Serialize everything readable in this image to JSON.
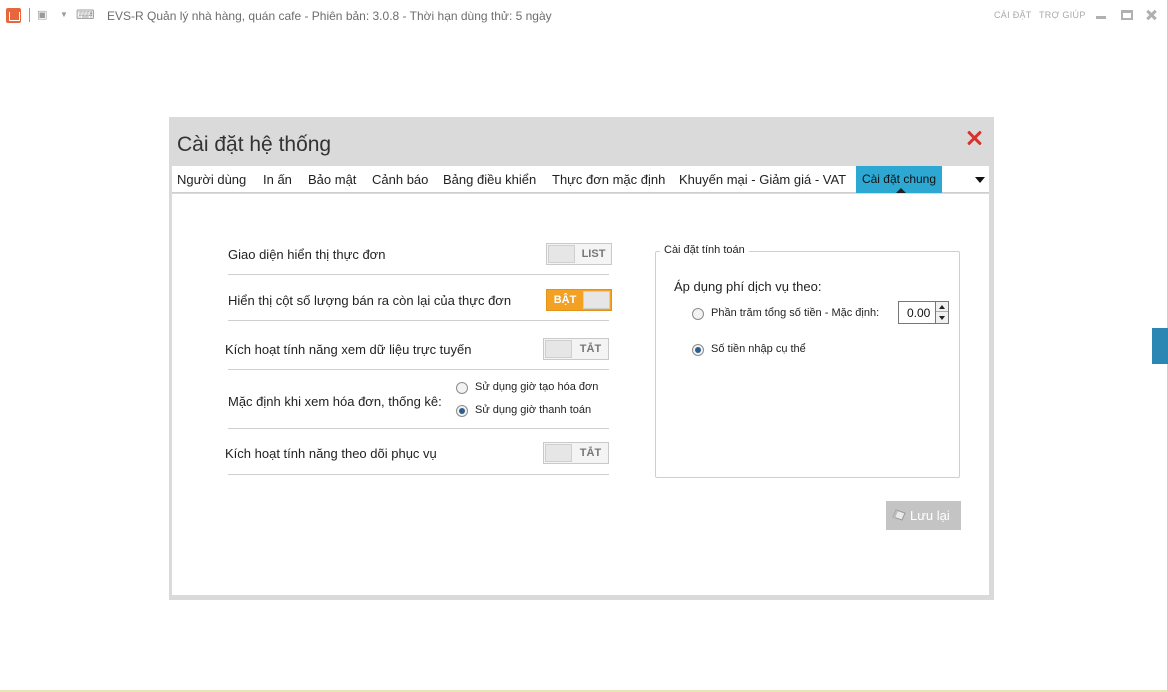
{
  "window": {
    "title": "EVS-R Quản lý nhà hàng, quán cafe - Phiên bản: 3.0.8 - Thời hạn dùng thử: 5 ngày",
    "links": {
      "settings": "CÀI ĐẶT",
      "help": "TRỢ GIÚP"
    }
  },
  "dialog": {
    "title": "Cài đặt hệ thống",
    "tabs": [
      "Người dùng",
      "In ấn",
      "Bảo mật",
      "Cảnh báo",
      "Bảng điều khiển",
      "Thực đơn mặc định",
      "Khuyến mại - Giảm giá - VAT",
      "Cài đặt chung"
    ],
    "active_tab": "Cài đặt chung"
  },
  "settings": {
    "menu_display": {
      "label": "Giao diện hiển thị thực đơn",
      "value": "LIST",
      "on": false
    },
    "show_remaining": {
      "label": "Hiển thị cột số lượng bán ra còn lại của thực đơn",
      "value": "BẬT",
      "on": true
    },
    "online_data": {
      "label": "Kích hoạt tính năng xem dữ liệu trực tuyến",
      "value": "TẮT",
      "on": false
    },
    "invoice_default": {
      "label": "Mặc định khi xem hóa đơn, thống kê:",
      "options": [
        "Sử dụng giờ tạo hóa đơn",
        "Sử dụng giờ  thanh toán"
      ],
      "selected": 1
    },
    "service_tracking": {
      "label": "Kích hoạt tính năng theo dõi phục vụ",
      "value": "TẮT",
      "on": false
    }
  },
  "calc": {
    "group_title": "Cài đặt tính toán",
    "service_fee_label": "Áp dụng phí dịch vụ theo:",
    "options": [
      "Phần trăm tổng số tiền -  Mặc định:",
      "Số tiền nhập cụ thể"
    ],
    "selected": 1,
    "default_value": "0.00"
  },
  "save_label": "Lưu lại",
  "colors": {
    "accent": "#2da8d3",
    "toggle_on": "#f2a122",
    "close": "#d9312c"
  }
}
